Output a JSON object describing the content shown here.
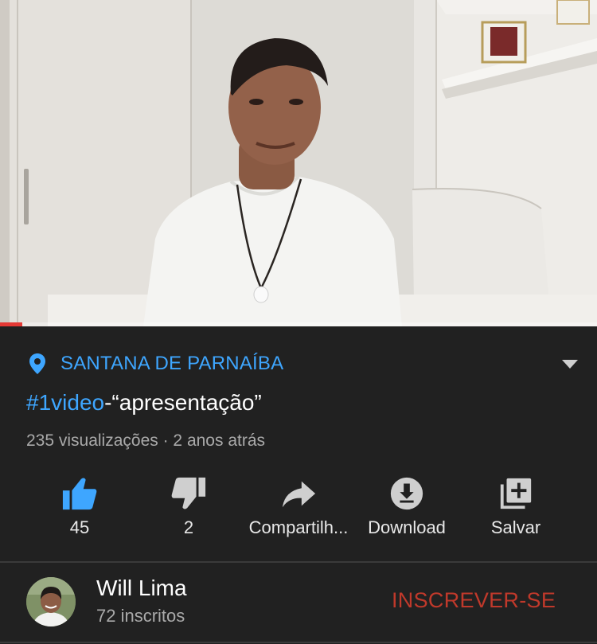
{
  "video": {
    "progress_fraction": 0.037
  },
  "location": {
    "icon": "location-pin-icon",
    "text": "SANTANA DE PARNAÍBA",
    "color": "#3ea6ff"
  },
  "title": {
    "hashtag": "#1video",
    "rest": "-“apresentação”"
  },
  "meta": {
    "views_and_date": "235 visualizações · 2 anos atrás"
  },
  "actions": {
    "like": {
      "icon": "thumbs-up-icon",
      "label": "45",
      "active": true,
      "color": "#3ea6ff"
    },
    "dislike": {
      "icon": "thumbs-down-icon",
      "label": "2"
    },
    "share": {
      "icon": "share-arrow-icon",
      "label": "Compartilh..."
    },
    "download": {
      "icon": "download-icon",
      "label": "Download"
    },
    "save": {
      "icon": "add-to-playlist-icon",
      "label": "Salvar"
    }
  },
  "channel": {
    "name": "Will Lima",
    "subscribers": "72 inscritos",
    "subscribe_label": "INSCREVER-SE",
    "subscribe_color": "#c0392b"
  }
}
